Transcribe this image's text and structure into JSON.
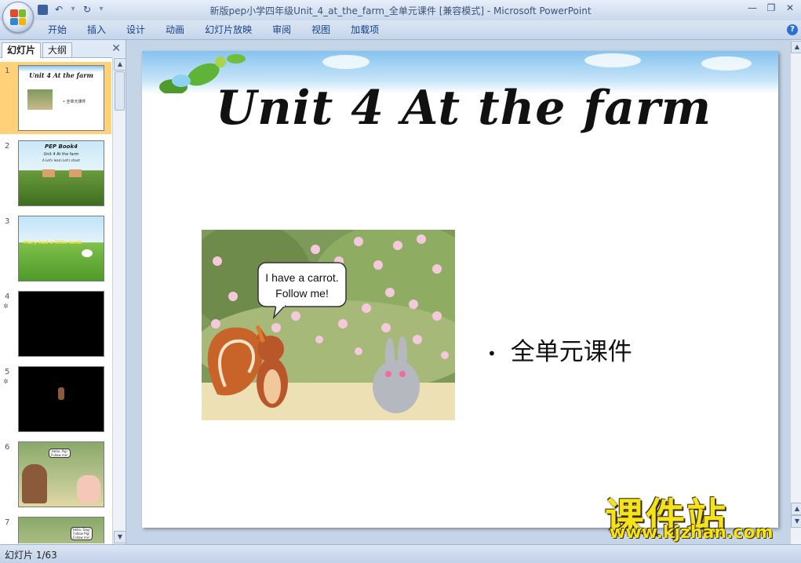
{
  "window": {
    "title": "新版pep小学四年级Unit_4_at_the_farm_全单元课件 [兼容模式] - Microsoft PowerPoint"
  },
  "ribbon": {
    "tabs": [
      "开始",
      "插入",
      "设计",
      "动画",
      "幻灯片放映",
      "审阅",
      "视图",
      "加载项"
    ]
  },
  "left_pane": {
    "tabs": [
      "幻灯片",
      "大纲"
    ],
    "thumbnails": [
      {
        "number": "1",
        "title": "Unit 4 At the farm",
        "caption": "• 全单元课件"
      },
      {
        "number": "2",
        "title": "PEP Book4",
        "subtitle": "Unit 4  At the farm",
        "line3": "A Let's learn      Let's chant"
      },
      {
        "number": "3",
        "title": "Mary had a little lamb"
      },
      {
        "number": "4"
      },
      {
        "number": "5"
      },
      {
        "number": "6",
        "bubble": "Hello, Pig! Follow me!"
      },
      {
        "number": "7",
        "bubble": "Hello, Dog! Follow Pig! Follow me!"
      }
    ]
  },
  "slide": {
    "title": "Unit 4 At the farm",
    "bubble_line1": "I have a carrot.",
    "bubble_line2": "Follow me!",
    "bullet": "全单元课件"
  },
  "watermark": {
    "text": "课件站",
    "url": "www.kjzhan.com"
  },
  "status": {
    "slide_counter": "幻灯片 1/63"
  },
  "colors": {
    "ribbon_text": "#15428b",
    "selected_thumb": "#ffd27a",
    "watermark": "#f4e21a"
  }
}
